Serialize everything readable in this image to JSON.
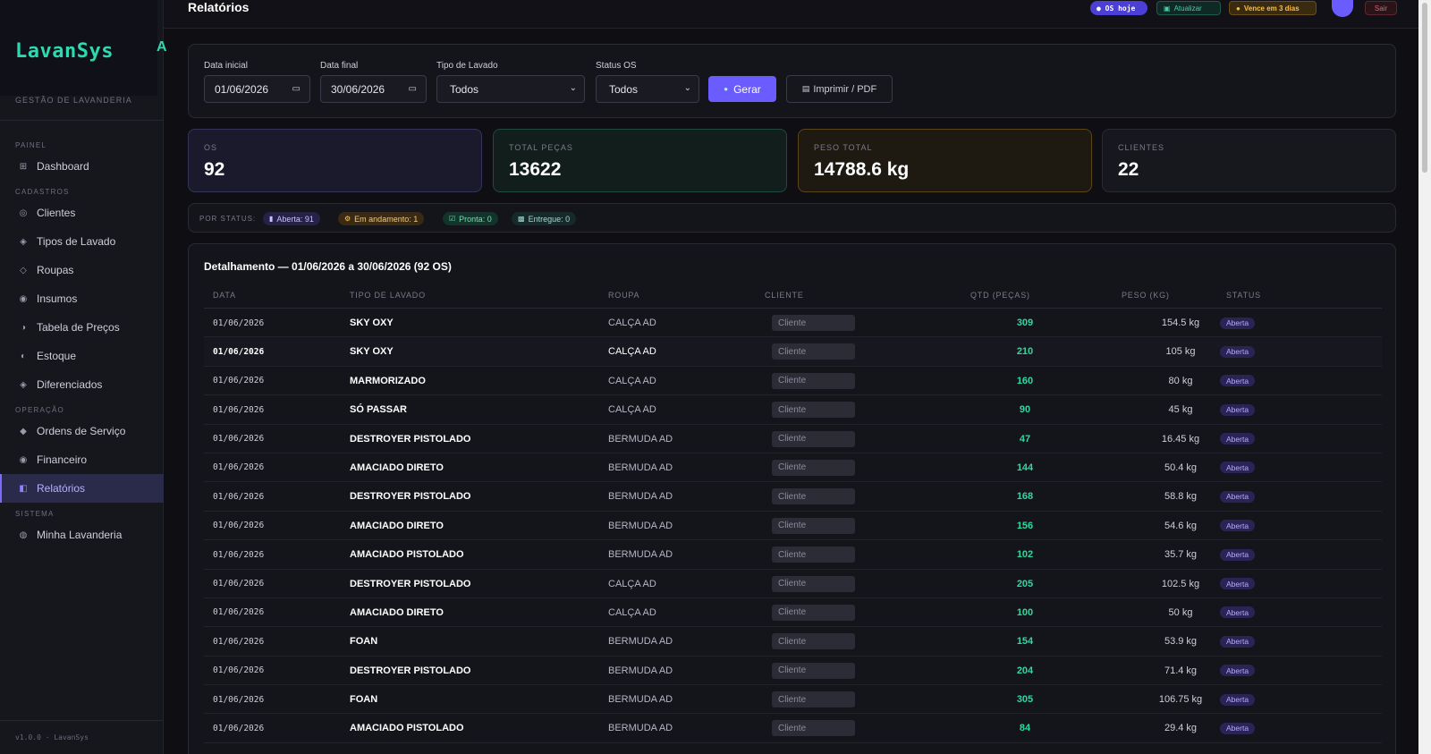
{
  "brand": {
    "title": "LavanSys",
    "mark": "A",
    "subtitle": "GESTÃO DE LAVANDERIA"
  },
  "sidebar": {
    "sections": [
      {
        "label": "PAINEL",
        "items": [
          {
            "label": "Dashboard",
            "icon": "grid-icon"
          }
        ]
      },
      {
        "label": "CADASTROS",
        "items": [
          {
            "label": "Clientes",
            "icon": "users-icon"
          },
          {
            "label": "Tipos de Lavado",
            "icon": "diamond-icon"
          },
          {
            "label": "Roupas",
            "icon": "shirt-icon"
          },
          {
            "label": "Insumos",
            "icon": "flask-icon"
          },
          {
            "label": "Tabela de Preços",
            "icon": "price-icon"
          },
          {
            "label": "Estoque",
            "icon": "box-icon"
          },
          {
            "label": "Diferenciados",
            "icon": "star-icon"
          }
        ]
      },
      {
        "label": "OPERAÇÃO",
        "items": [
          {
            "label": "Ordens de Serviço",
            "icon": "clipboard-icon"
          },
          {
            "label": "Financeiro",
            "icon": "money-icon"
          },
          {
            "label": "Relatórios",
            "icon": "report-icon",
            "active": true
          }
        ]
      },
      {
        "label": "SISTEMA",
        "items": [
          {
            "label": "Minha Lavanderia",
            "icon": "store-icon"
          }
        ]
      }
    ],
    "footer": "v1.0.0 · LavanSys"
  },
  "topbar": {
    "title": "Relatórios",
    "os_hoje": "● OS hoje",
    "atualizar": "Atualizar",
    "vence": "Vence em 3 dias",
    "sair": "Sair"
  },
  "filters": {
    "data_inicial": {
      "label": "Data inicial",
      "value": "01/06/2026"
    },
    "data_final": {
      "label": "Data final",
      "value": "30/06/2026"
    },
    "tipo_lavado": {
      "label": "Tipo de Lavado",
      "value": "Todos"
    },
    "status_os": {
      "label": "Status OS",
      "value": "Todos"
    },
    "gerar": "Gerar",
    "imprimir": "Imprimir / PDF"
  },
  "stats": {
    "os": {
      "label": "OS",
      "value": "92"
    },
    "pecas": {
      "label": "TOTAL PEÇAS",
      "value": "13622"
    },
    "peso": {
      "label": "PESO TOTAL",
      "value": "14788.6 kg"
    },
    "clientes": {
      "label": "CLIENTES",
      "value": "22"
    }
  },
  "status_bar": {
    "label": "POR STATUS:",
    "aberta": "Aberta: 91",
    "andamento": "Em andamento: 1",
    "pronta": "Pronta: 0",
    "entregue": "Entregue: 0"
  },
  "table": {
    "title": "Detalhamento — 01/06/2026 a 30/06/2026 (92 OS)",
    "headers": {
      "data": "DATA",
      "tipo": "TIPO DE LAVADO",
      "roupa": "ROUPA",
      "cliente": "CLIENTE",
      "qtd": "QTD (PEÇAS)",
      "peso": "PESO (KG)",
      "status": "STATUS"
    },
    "rows": [
      {
        "data": "01/06/2026",
        "tipo": "SKY OXY",
        "roupa": "CALÇA AD",
        "cliente": "Cliente",
        "qtd": "309",
        "peso": "154.5 kg",
        "status": "Aberta"
      },
      {
        "data": "01/06/2026",
        "tipo": "SKY OXY",
        "roupa": "CALÇA AD",
        "cliente": "Cliente",
        "qtd": "210",
        "peso": "105 kg",
        "status": "Aberta"
      },
      {
        "data": "01/06/2026",
        "tipo": "MARMORIZADO",
        "roupa": "CALÇA AD",
        "cliente": "Cliente",
        "qtd": "160",
        "peso": "80 kg",
        "status": "Aberta"
      },
      {
        "data": "01/06/2026",
        "tipo": "SÓ PASSAR",
        "roupa": "CALÇA AD",
        "cliente": "Cliente",
        "qtd": "90",
        "peso": "45 kg",
        "status": "Aberta"
      },
      {
        "data": "01/06/2026",
        "tipo": "DESTROYER PISTOLADO",
        "roupa": "BERMUDA AD",
        "cliente": "Cliente",
        "qtd": "47",
        "peso": "16.45 kg",
        "status": "Aberta"
      },
      {
        "data": "01/06/2026",
        "tipo": "AMACIADO DIRETO",
        "roupa": "BERMUDA AD",
        "cliente": "Cliente",
        "qtd": "144",
        "peso": "50.4 kg",
        "status": "Aberta"
      },
      {
        "data": "01/06/2026",
        "tipo": "DESTROYER PISTOLADO",
        "roupa": "BERMUDA AD",
        "cliente": "Cliente",
        "qtd": "168",
        "peso": "58.8 kg",
        "status": "Aberta"
      },
      {
        "data": "01/06/2026",
        "tipo": "AMACIADO DIRETO",
        "roupa": "BERMUDA AD",
        "cliente": "Cliente",
        "qtd": "156",
        "peso": "54.6 kg",
        "status": "Aberta"
      },
      {
        "data": "01/06/2026",
        "tipo": "AMACIADO PISTOLADO",
        "roupa": "BERMUDA AD",
        "cliente": "Cliente",
        "qtd": "102",
        "peso": "35.7 kg",
        "status": "Aberta"
      },
      {
        "data": "01/06/2026",
        "tipo": "DESTROYER PISTOLADO",
        "roupa": "CALÇA AD",
        "cliente": "Cliente",
        "qtd": "205",
        "peso": "102.5 kg",
        "status": "Aberta"
      },
      {
        "data": "01/06/2026",
        "tipo": "AMACIADO DIRETO",
        "roupa": "CALÇA AD",
        "cliente": "Cliente",
        "qtd": "100",
        "peso": "50 kg",
        "status": "Aberta"
      },
      {
        "data": "01/06/2026",
        "tipo": "FOAN",
        "roupa": "BERMUDA AD",
        "cliente": "Cliente",
        "qtd": "154",
        "peso": "53.9 kg",
        "status": "Aberta"
      },
      {
        "data": "01/06/2026",
        "tipo": "DESTROYER PISTOLADO",
        "roupa": "BERMUDA AD",
        "cliente": "Cliente",
        "qtd": "204",
        "peso": "71.4 kg",
        "status": "Aberta"
      },
      {
        "data": "01/06/2026",
        "tipo": "FOAN",
        "roupa": "BERMUDA AD",
        "cliente": "Cliente",
        "qtd": "305",
        "peso": "106.75 kg",
        "status": "Aberta"
      },
      {
        "data": "01/06/2026",
        "tipo": "AMACIADO PISTOLADO",
        "roupa": "BERMUDA AD",
        "cliente": "Cliente",
        "qtd": "84",
        "peso": "29.4 kg",
        "status": "Aberta"
      }
    ]
  },
  "colors": {
    "accent": "#6b5cff",
    "teal": "#2ed9b0",
    "qty_green": "#2ed9a0",
    "background": "#0f0f13"
  }
}
